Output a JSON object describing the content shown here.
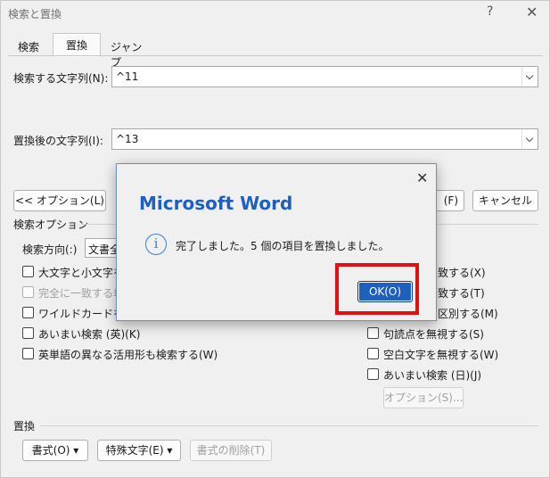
{
  "window": {
    "title": "検索と置換",
    "help": "?",
    "close": "✕"
  },
  "tabs": [
    {
      "label": "検索",
      "active": false
    },
    {
      "label": "置換",
      "active": true
    },
    {
      "label": "ジャンプ",
      "active": false
    }
  ],
  "find": {
    "label": "検索する文字列(N):",
    "value": "^11"
  },
  "replace": {
    "label": "置換後の文字列(I):",
    "value": "^13"
  },
  "buttons": {
    "options": "<< オプション(L)",
    "find_next_tail": "(F)",
    "cancel": "キャンセル",
    "format": "書式(O) ▾",
    "special": "特殊文字(E) ▾",
    "clear_format": "書式の削除(T)",
    "options_sub": "オプション(S)..."
  },
  "search_options": {
    "heading": "検索オプション",
    "direction_label": "検索方向(:)",
    "direction_value": "文書全",
    "left": [
      {
        "label": "大文字と小文字を",
        "disabled": false
      },
      {
        "label": "完全に一致する単",
        "disabled": true
      },
      {
        "label": "ワイルドカードを使用",
        "disabled": false
      },
      {
        "label": "あいまい検索 (英)(K)",
        "disabled": false
      },
      {
        "label": "英単語の異なる活用形も検索する(W)",
        "disabled": false
      }
    ],
    "right_partial": [
      {
        "label": "致する(X)"
      },
      {
        "label": "致する(T)"
      },
      {
        "label": "区別する(M)"
      }
    ],
    "right": [
      {
        "label": "句読点を無視する(S)"
      },
      {
        "label": "空白文字を無視する(W)"
      },
      {
        "label": "あいまい検索 (日)(J)"
      }
    ]
  },
  "replace_section": {
    "heading": "置換"
  },
  "dialog": {
    "title": "Microsoft Word",
    "message": "完了しました。5 個の項目を置換しました。",
    "ok": "OK(O)",
    "close": "✕",
    "info_icon": "i"
  },
  "colors": {
    "accent": "#1f5fbf",
    "highlight": "#e01010"
  }
}
